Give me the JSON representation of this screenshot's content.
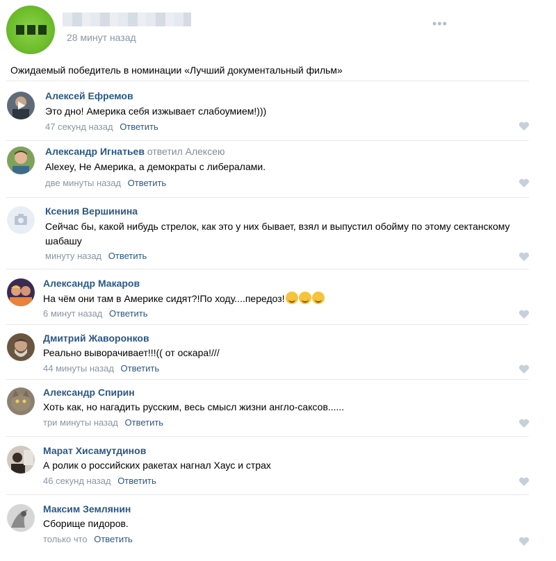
{
  "post": {
    "time": "28 минут назад",
    "menu": "•••",
    "text": "Ожидаемый победитель в номинации «Лучший документальный фильм»"
  },
  "reply_label": "Ответить",
  "comments": [
    {
      "name": "Алексей Ефремов",
      "reply_to": "",
      "text": "Это дно! Америка себя изжывает слабоумием!)))",
      "time": "47 секунд назад"
    },
    {
      "name": "Александр Игнатьев",
      "reply_to": "ответил Алексею",
      "text": "Alexey, Не Америка, а демократы с либералами.",
      "time": "две минуты назад"
    },
    {
      "name": "Ксения Вершинина",
      "reply_to": "",
      "text": "Сейчас бы, какой нибудь стрелок, как это у них бывает, взял и выпустил обойму по этому сектанскому шабашу",
      "time": "минуту назад"
    },
    {
      "name": "Александр Макаров",
      "reply_to": "",
      "text": "На чём они там в Америке сидят?!По ходу....передоз!",
      "time": "6 минут назад"
    },
    {
      "name": "Дмитрий Жаворонков",
      "reply_to": "",
      "text": "Реально выворачивает!!!(( от оскара!///",
      "time": "44 минуты назад"
    },
    {
      "name": "Александр Спирин",
      "reply_to": "",
      "text": "Хоть как, но нагадить русским, весь смысл жизни англо-саксов......",
      "time": "три минуты назад"
    },
    {
      "name": "Марат Хисамутдинов",
      "reply_to": "",
      "text": "А ролик о российских ракетах нагнал Хаус и страх",
      "time": "46 секунд назад"
    },
    {
      "name": "Максим Землянин",
      "reply_to": "",
      "text": "Сборище пидоров.",
      "time": "только что"
    }
  ],
  "colors": {
    "link": "#2a5885",
    "meta": "#8a95a3",
    "separator": "#e7e8ec",
    "like_icon": "#c5d0db"
  }
}
